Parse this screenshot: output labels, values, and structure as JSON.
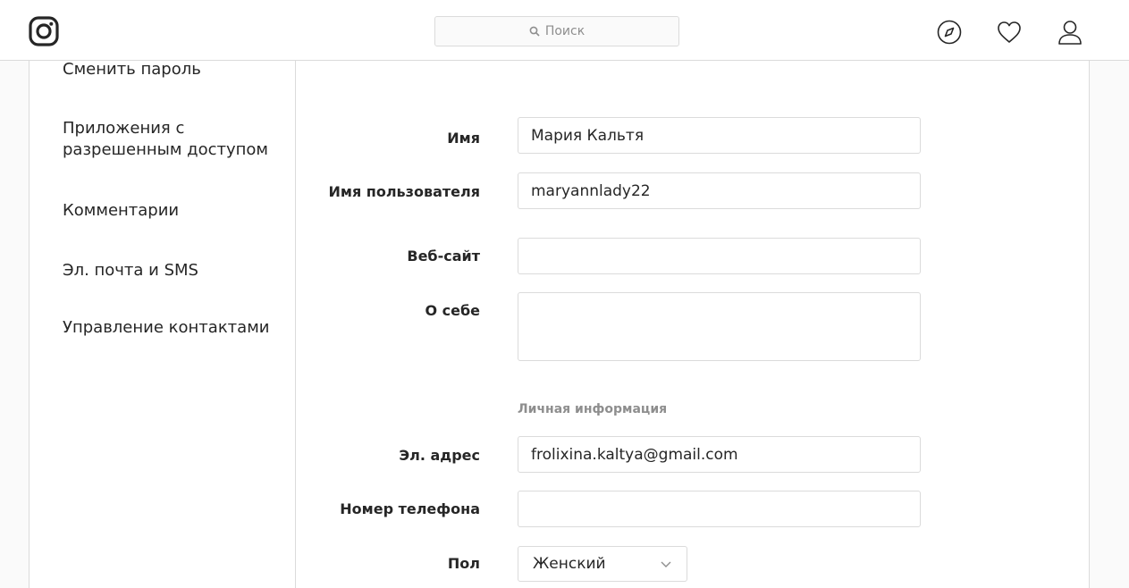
{
  "header": {
    "search_placeholder": "Поиск"
  },
  "sidebar": {
    "items": [
      {
        "label": "Сменить пароль"
      },
      {
        "label": "Приложения с разрешенным доступом"
      },
      {
        "label": "Комментарии"
      },
      {
        "label": "Эл. почта и SMS"
      },
      {
        "label": "Управление контактами"
      }
    ]
  },
  "form": {
    "name": {
      "label": "Имя",
      "value": "Мария Кальтя"
    },
    "username": {
      "label": "Имя пользователя",
      "value": "maryannlady22"
    },
    "website": {
      "label": "Веб-сайт",
      "value": ""
    },
    "bio": {
      "label": "О себе",
      "value": ""
    },
    "personal_section_title": "Личная информация",
    "email": {
      "label": "Эл. адрес",
      "value": "frolixina.kaltya@gmail.com"
    },
    "phone": {
      "label": "Номер телефона",
      "value": ""
    },
    "gender": {
      "label": "Пол",
      "value": "Женский"
    }
  },
  "icons": {
    "logo": "instagram-logo",
    "search": "search-icon",
    "explore": "compass-icon",
    "activity": "heart-icon",
    "profile": "user-icon",
    "select_arrow": "chevron-down-icon"
  },
  "colors": {
    "border": "#dbdbdb",
    "text": "#262626",
    "muted": "#8e8e8e",
    "background": "#fafafa"
  }
}
